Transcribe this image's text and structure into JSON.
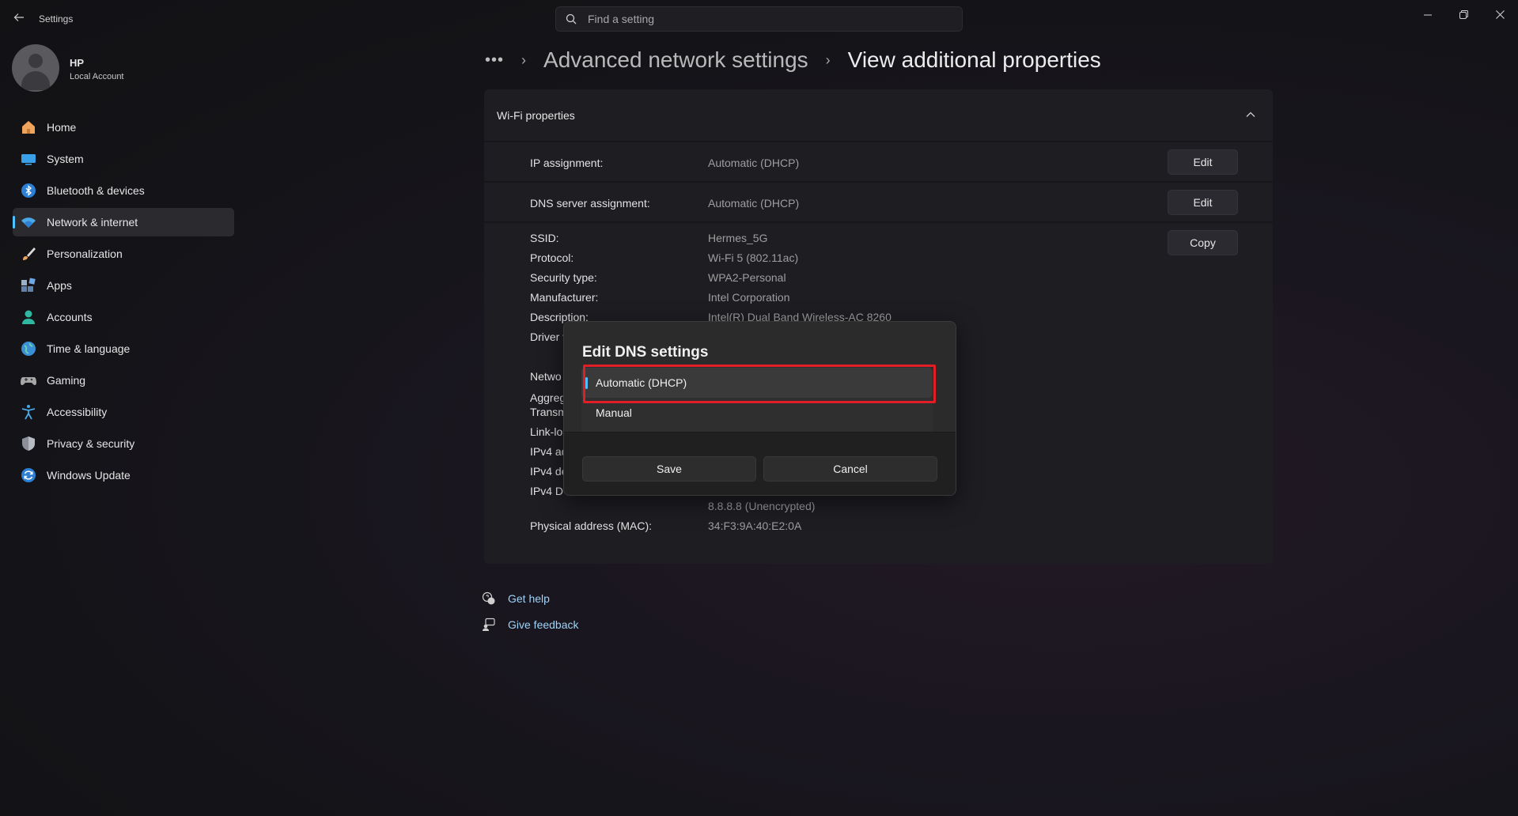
{
  "window": {
    "app_title": "Settings",
    "search_placeholder": "Find a setting"
  },
  "profile": {
    "name": "HP",
    "account_type": "Local Account"
  },
  "sidebar": {
    "items": [
      {
        "label": "Home",
        "icon": "home-icon",
        "active": false
      },
      {
        "label": "System",
        "icon": "system-icon",
        "active": false
      },
      {
        "label": "Bluetooth & devices",
        "icon": "bluetooth-icon",
        "active": false
      },
      {
        "label": "Network & internet",
        "icon": "wifi-icon",
        "active": true
      },
      {
        "label": "Personalization",
        "icon": "brush-icon",
        "active": false
      },
      {
        "label": "Apps",
        "icon": "apps-icon",
        "active": false
      },
      {
        "label": "Accounts",
        "icon": "accounts-icon",
        "active": false
      },
      {
        "label": "Time & language",
        "icon": "globe-icon",
        "active": false
      },
      {
        "label": "Gaming",
        "icon": "gamepad-icon",
        "active": false
      },
      {
        "label": "Accessibility",
        "icon": "accessibility-icon",
        "active": false
      },
      {
        "label": "Privacy & security",
        "icon": "shield-icon",
        "active": false
      },
      {
        "label": "Windows Update",
        "icon": "update-icon",
        "active": false
      }
    ]
  },
  "breadcrumb": {
    "more": "•••",
    "parent": "Advanced network settings",
    "current": "View additional properties"
  },
  "card": {
    "title": "Wi-Fi properties",
    "ip_assignment": {
      "label": "IP assignment:",
      "value": "Automatic (DHCP)",
      "button": "Edit"
    },
    "dns_assignment": {
      "label": "DNS server assignment:",
      "value": "Automatic (DHCP)",
      "button": "Edit"
    },
    "copy_button": "Copy",
    "details": [
      {
        "label": "SSID:",
        "value": "Hermes_5G"
      },
      {
        "label": "Protocol:",
        "value": "Wi-Fi 5 (802.11ac)"
      },
      {
        "label": "Security type:",
        "value": "WPA2-Personal"
      },
      {
        "label": "Manufacturer:",
        "value": "Intel Corporation"
      },
      {
        "label": "Description:",
        "value": "Intel(R) Dual Band Wireless-AC 8260"
      }
    ],
    "partial_labels": [
      "Driver v",
      "Netwo",
      "Aggreg",
      "Transm",
      "Link-lo",
      "IPv4 ad",
      "IPv4 de",
      "IPv4 D"
    ],
    "dns_secondary": "8.8.8.8 (Unencrypted)",
    "mac": {
      "label": "Physical address (MAC):",
      "value": "34:F3:9A:40:E2:0A"
    }
  },
  "links": {
    "help": "Get help",
    "feedback": "Give feedback"
  },
  "dialog": {
    "title": "Edit DNS settings",
    "options": [
      "Automatic (DHCP)",
      "Manual"
    ],
    "selected": "Automatic (DHCP)",
    "save": "Save",
    "cancel": "Cancel"
  },
  "colors": {
    "accent": "#4cc2ff",
    "highlight": "#e21d25",
    "link": "#9fd3f7"
  }
}
